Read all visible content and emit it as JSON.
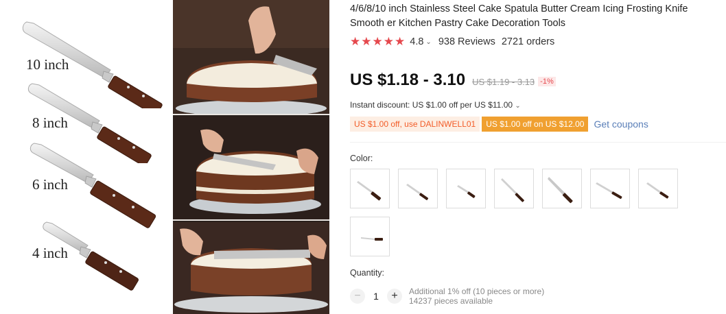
{
  "product": {
    "title": "4/6/8/10 inch Stainless Steel Cake Spatula Butter Cream Icing Frosting Knife Smooth er Kitchen Pastry Cake Decoration Tools"
  },
  "image": {
    "sizes": [
      "10 inch",
      "8 inch",
      "6 inch",
      "4 inch"
    ]
  },
  "rating": {
    "stars": 5,
    "value": "4.8",
    "reviews": "938 Reviews",
    "orders": "2721 orders",
    "star_color": "#e5484d"
  },
  "price": {
    "current": "US $1.18 - 3.10",
    "original": "US $1.19 - 3.13",
    "discount": "-1%"
  },
  "instant_discount": "Instant discount: US $1.00 off per US $11.00",
  "coupons": {
    "coupon_one": "US $1.00 off, use DALINWELL01",
    "coupon_two": "US $1.00 off on US $12.00",
    "get_coupons": "Get coupons"
  },
  "color": {
    "label": "Color:",
    "swatch_count": 8
  },
  "quantity": {
    "label": "Quantity:",
    "decrement": "−",
    "value": "1",
    "increment": "+",
    "note": "Additional 1% off (10 pieces or more)",
    "available": "14237 pieces available"
  }
}
